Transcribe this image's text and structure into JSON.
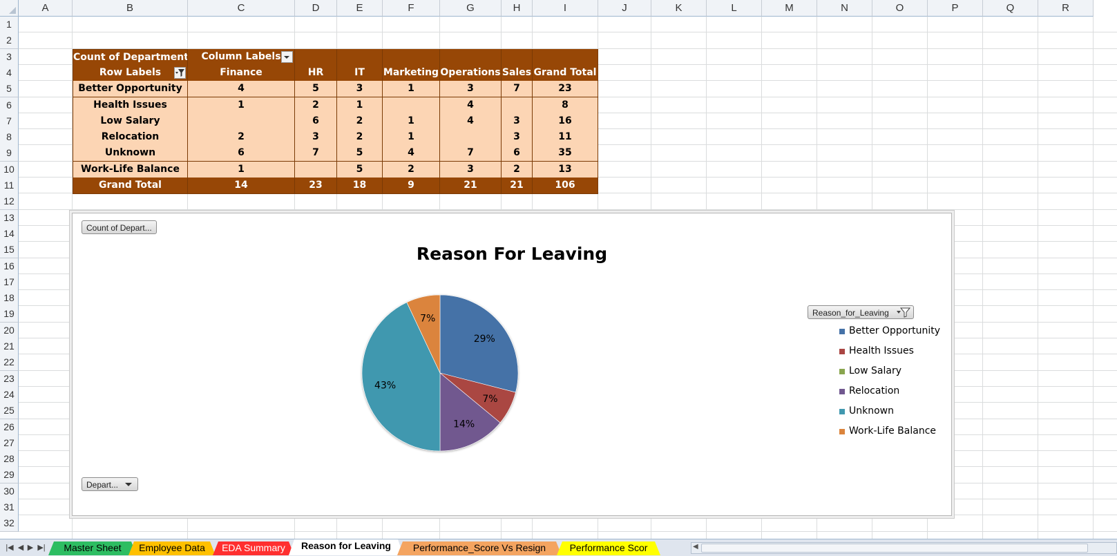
{
  "columns": [
    "A",
    "B",
    "C",
    "D",
    "E",
    "F",
    "G",
    "H",
    "I",
    "J",
    "K",
    "L",
    "M",
    "N",
    "O",
    "P",
    "Q",
    "R"
  ],
  "rows": [
    "1",
    "2",
    "3",
    "4",
    "5",
    "6",
    "7",
    "8",
    "9",
    "10",
    "11",
    "12",
    "13",
    "14",
    "15",
    "16",
    "17",
    "18",
    "19",
    "20",
    "21",
    "22",
    "23",
    "24",
    "25",
    "26",
    "27",
    "28",
    "29",
    "30",
    "31",
    "32"
  ],
  "pivot": {
    "count_label": "Count of Department",
    "column_labels": "Column Labels",
    "row_labels": "Row Labels",
    "headers": [
      "Finance",
      "HR",
      "IT",
      "Marketing",
      "Operations",
      "Sales",
      "Grand Total"
    ],
    "rows": [
      {
        "label": "Better Opportunity",
        "values": [
          "4",
          "5",
          "3",
          "1",
          "3",
          "7",
          "23"
        ]
      },
      {
        "label": "Health Issues",
        "values": [
          "1",
          "2",
          "1",
          "",
          "4",
          "",
          "8"
        ]
      },
      {
        "label": "Low Salary",
        "values": [
          "",
          "6",
          "2",
          "1",
          "4",
          "3",
          "16"
        ]
      },
      {
        "label": "Relocation",
        "values": [
          "2",
          "3",
          "2",
          "1",
          "",
          "3",
          "11"
        ]
      },
      {
        "label": "Unknown",
        "values": [
          "6",
          "7",
          "5",
          "4",
          "7",
          "6",
          "35"
        ]
      },
      {
        "label": "Work-Life Balance",
        "values": [
          "1",
          "",
          "5",
          "2",
          "3",
          "2",
          "13"
        ]
      }
    ],
    "grand_total_label": "Grand Total",
    "grand_total_values": [
      "14",
      "23",
      "18",
      "9",
      "21",
      "21",
      "106"
    ],
    "colors": {
      "header_bg": "#974706",
      "body_bg": "#fcd5b4"
    }
  },
  "chart": {
    "value_field_button": "Count of Depart...",
    "axis_field_button": "Depart...",
    "legend_field_button": "Reason_for_Leaving"
  },
  "chart_data": {
    "type": "pie",
    "title": "Reason For Leaving",
    "categories": [
      "Better Opportunity",
      "Health Issues",
      "Low Salary",
      "Relocation",
      "Unknown",
      "Work-Life Balance"
    ],
    "values": [
      29,
      7,
      0,
      14,
      43,
      7
    ],
    "data_labels": [
      "29%",
      "7%",
      "",
      "14%",
      "43%",
      "7%"
    ],
    "colors": [
      "#4572a7",
      "#aa4643",
      "#89a54e",
      "#71588f",
      "#4198af",
      "#db843d"
    ],
    "legend": "right"
  },
  "tabs": [
    {
      "label": "Master Sheet",
      "color": "#2dbd62",
      "active": false
    },
    {
      "label": "Employee Data",
      "color": "#ffc000",
      "active": false
    },
    {
      "label": "EDA Summary",
      "color": "#ff2f2f",
      "active": false
    },
    {
      "label": "Reason for Leaving",
      "color": "#ffffff",
      "active": true
    },
    {
      "label": "Performance_Score Vs Resign",
      "color": "#f4a460",
      "active": false
    },
    {
      "label": "Performance Scor",
      "color": "#ffff00",
      "active": false
    }
  ],
  "icons": {
    "filter": "filter-icon",
    "dropdown": "chevron-down-icon",
    "nav_first": "first-sheet-icon",
    "nav_prev": "prev-sheet-icon",
    "nav_next": "next-sheet-icon",
    "nav_last": "last-sheet-icon"
  }
}
